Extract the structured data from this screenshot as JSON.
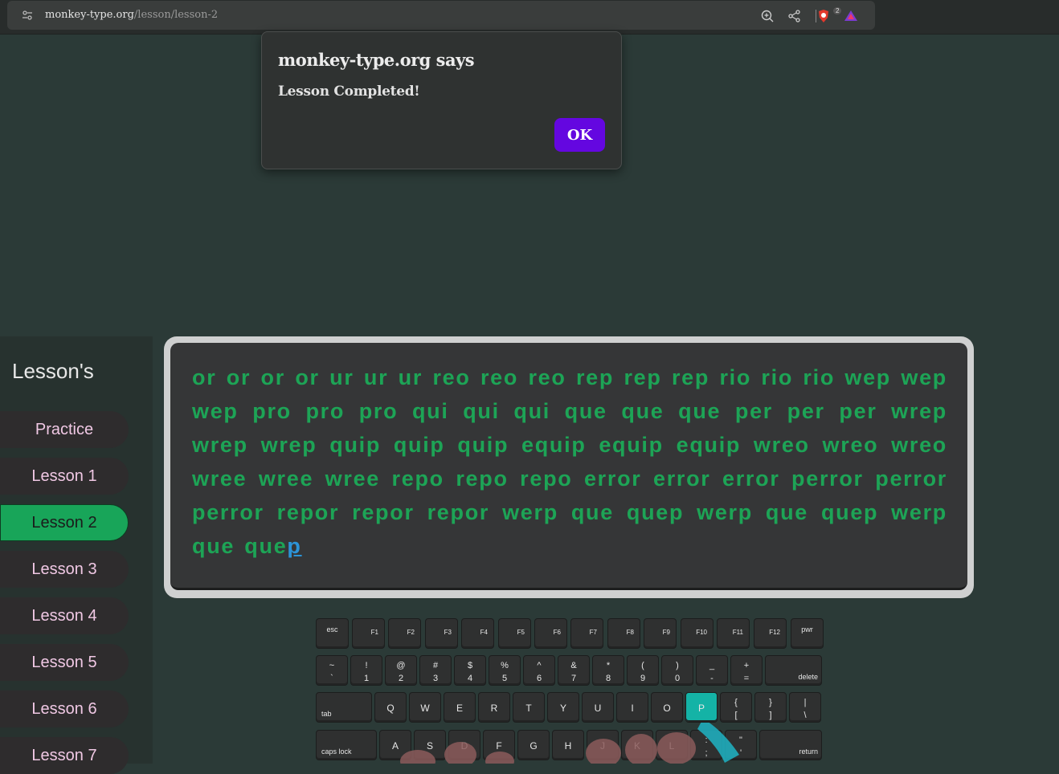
{
  "browser": {
    "url_domain": "monkey-type.org",
    "url_path": "/lesson/lesson-2",
    "shield_count": "2"
  },
  "dialog": {
    "title": "monkey-type.org says",
    "message": "Lesson Completed!",
    "ok_label": "OK"
  },
  "sidebar": {
    "title": "Lesson's",
    "items": [
      {
        "label": "Practice",
        "active": false
      },
      {
        "label": "Lesson 1",
        "active": false
      },
      {
        "label": "Lesson 2",
        "active": true
      },
      {
        "label": "Lesson 3",
        "active": false
      },
      {
        "label": "Lesson 4",
        "active": false
      },
      {
        "label": "Lesson 5",
        "active": false
      },
      {
        "label": "Lesson 6",
        "active": false
      },
      {
        "label": "Lesson 7",
        "active": false
      }
    ]
  },
  "typing": {
    "typed_text": "or or or or ur ur ur reo reo reo rep rep rep rio rio rio wep wep wep pro pro pro qui qui qui que que que per per per wrep wrep wrep quip quip quip equip equip equip wreo wreo wreo wree wree wree repo repo repo error error error perror perror perror repor repor repor werp que quep werp que quep werp que que",
    "current_char": "p"
  },
  "keyboard": {
    "highlighted_key": "P",
    "row_fn": [
      "esc",
      "F1",
      "F2",
      "F3",
      "F4",
      "F5",
      "F6",
      "F7",
      "F8",
      "F9",
      "F10",
      "F11",
      "F12",
      "pwr"
    ],
    "row_num": [
      {
        "top": "~",
        "bot": "`"
      },
      {
        "top": "!",
        "bot": "1"
      },
      {
        "top": "@",
        "bot": "2"
      },
      {
        "top": "#",
        "bot": "3"
      },
      {
        "top": "$",
        "bot": "4"
      },
      {
        "top": "%",
        "bot": "5"
      },
      {
        "top": "^",
        "bot": "6"
      },
      {
        "top": "&",
        "bot": "7"
      },
      {
        "top": "*",
        "bot": "8"
      },
      {
        "top": "(",
        "bot": "9"
      },
      {
        "top": ")",
        "bot": "0"
      },
      {
        "top": "_",
        "bot": "-"
      },
      {
        "top": "+",
        "bot": "="
      }
    ],
    "delete_label": "delete",
    "tab_label": "tab",
    "row_top": [
      "Q",
      "W",
      "E",
      "R",
      "T",
      "Y",
      "U",
      "I",
      "O",
      "P"
    ],
    "row_top_sym": [
      {
        "top": "{",
        "bot": "["
      },
      {
        "top": "}",
        "bot": "]"
      },
      {
        "top": "|",
        "bot": "\\"
      }
    ],
    "caps_label": "caps lock",
    "row_home": [
      "A",
      "S",
      "D",
      "F",
      "G",
      "H",
      "J",
      "K",
      "L"
    ],
    "row_home_sym": [
      {
        "top": ":",
        "bot": ";"
      },
      {
        "top": "\"",
        "bot": "'"
      }
    ],
    "return_label": "return"
  }
}
